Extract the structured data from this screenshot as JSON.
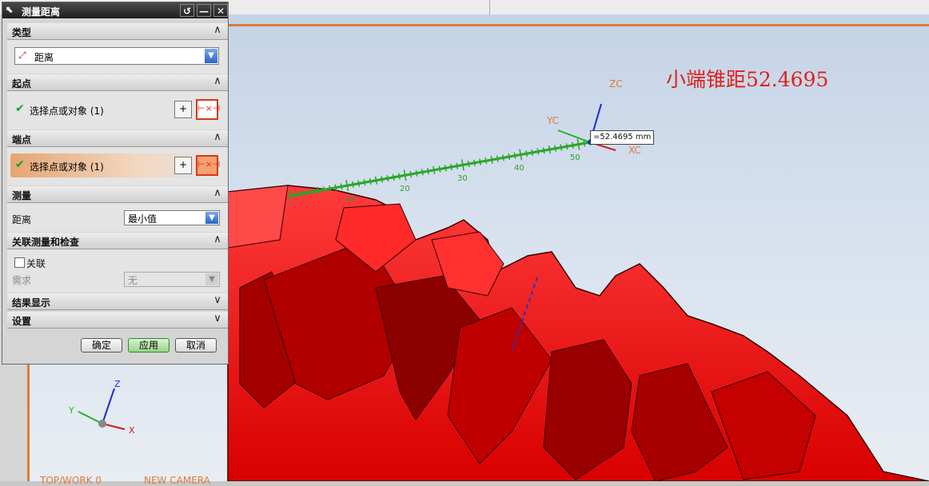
{
  "dialog": {
    "title": "测量距离",
    "reset_glyph": "↺",
    "minimize_glyph": "—",
    "close_glyph": "✕",
    "sections": {
      "type": {
        "label": "类型",
        "value": "距离"
      },
      "start": {
        "label": "起点",
        "selection": "选择点或对象 (1)"
      },
      "end": {
        "label": "端点",
        "selection": "选择点或对象 (1)"
      },
      "measure": {
        "label": "测量",
        "field_label": "距离",
        "value": "最小值"
      },
      "assoc": {
        "label": "关联测量和检查",
        "checkbox_label": "关联",
        "req_label": "需求",
        "req_value": "无"
      },
      "results": {
        "label": "结果显示"
      },
      "settings": {
        "label": "设置"
      }
    },
    "buttons": {
      "ok": "确定",
      "apply": "应用",
      "cancel": "取消"
    }
  },
  "viewport": {
    "annotation": "小端锥距52.4695",
    "measure_label": "=52.4695 mm",
    "ruler_ticks": [
      "10",
      "20",
      "30",
      "40",
      "50"
    ],
    "csys_labels": {
      "zc": "ZC",
      "yc": "YC",
      "xc": "XC"
    },
    "triad_labels": {
      "z": "Z",
      "y": "Y",
      "x": "X"
    },
    "footer_left": "TOP/WORK 0",
    "footer_right": "NEW CAMERA"
  },
  "colors": {
    "accent": "#e07a3a",
    "gear_red": "#ff1a1a",
    "dim_green": "#2aa52a",
    "annotation_red": "#e0201c"
  }
}
